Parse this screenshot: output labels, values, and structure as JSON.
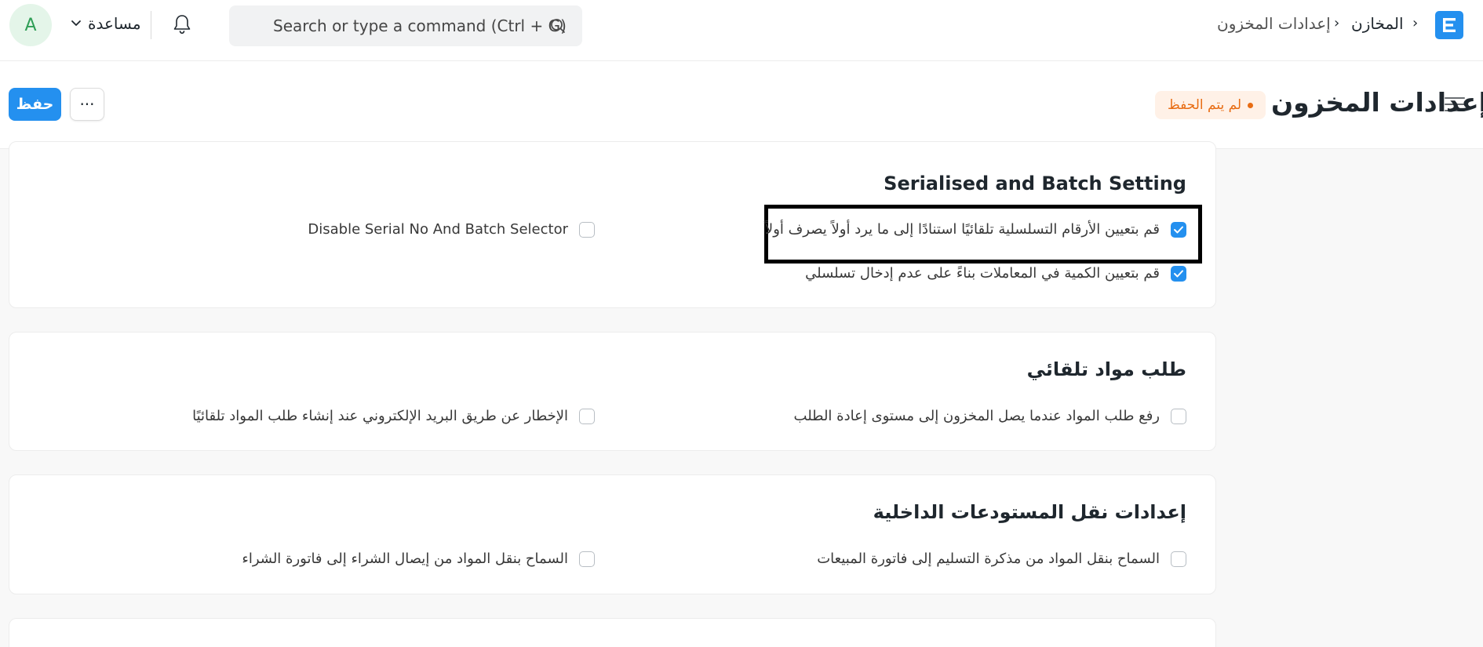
{
  "navbar": {
    "breadcrumbs": [
      "المخازن",
      "إعدادات المخزون"
    ],
    "search_placeholder": "Search or type a command (Ctrl + G)",
    "help_label": "مساعدة",
    "avatar_letter": "A"
  },
  "page": {
    "title": "إعدادات المخزون",
    "status": "لم يتم الحفظ",
    "more_label": "···",
    "save_label": "حفظ"
  },
  "sections": [
    {
      "title": "Serialised and Batch Setting",
      "fields": [
        {
          "label": "قم بتعيين الأرقام التسلسلية تلقائيًا استنادًا إلى ما يرد أولاً يصرف أولاً",
          "checked": true,
          "highlighted": true
        },
        {
          "label": "قم بتعيين الكمية في المعاملات بناءً على عدم إدخال تسلسلي",
          "checked": true
        },
        {
          "label": "Disable Serial No And Batch Selector",
          "checked": false
        }
      ]
    },
    {
      "title": "طلب مواد تلقائي",
      "fields": [
        {
          "label": "رفع طلب المواد عندما يصل المخزون إلى مستوى إعادة الطلب",
          "checked": false
        },
        {
          "label": "الإخطار عن طريق البريد الإلكتروني عند إنشاء طلب المواد تلقائيًا",
          "checked": false
        }
      ]
    },
    {
      "title": "إعدادات نقل المستودعات الداخلية",
      "fields": [
        {
          "label": "السماح بنقل المواد من مذكرة التسليم إلى فاتورة المبيعات",
          "checked": false
        },
        {
          "label": "السماح بنقل المواد من إيصال الشراء إلى فاتورة الشراء",
          "checked": false
        }
      ]
    }
  ],
  "colors": {
    "accent": "#2490ef",
    "status_orange": "#e86c13",
    "status_bg": "#fff1e7"
  }
}
